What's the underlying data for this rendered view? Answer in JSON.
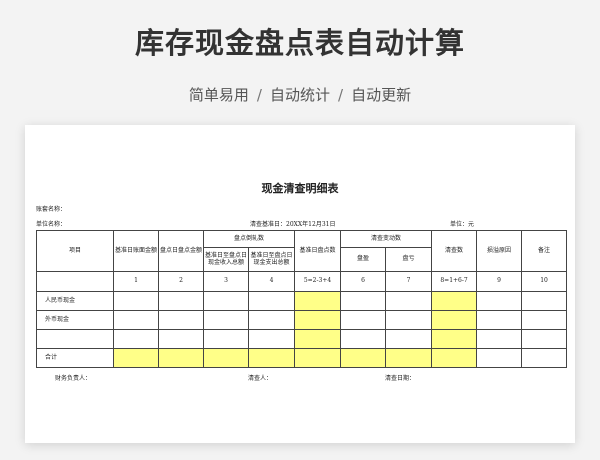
{
  "banner": {
    "title": "库存现金盘点表自动计算",
    "tags": [
      "简单易用",
      "自动统计",
      "自动更新"
    ],
    "separator": "/"
  },
  "document": {
    "title": "现金清查明细表",
    "account_name_label": "账套名称：",
    "unit_name_label": "单位名称：",
    "base_date_label": "清查基准日：20XX年12月31日",
    "unit_label": "单位：元",
    "headers": {
      "item": "项目",
      "base_book_balance": "基准日账面金额",
      "count_day_amount": "盘点日盘点金额",
      "count_adjustment": "盘点倒轧数",
      "income_total": "基准日至盘点日现金收入总额",
      "expense_total": "基准日至盘点日现金支出总额",
      "base_count_amount": "基准日盘点数",
      "change_amount": "清查变动数",
      "surplus": "盘盈",
      "loss": "盘亏",
      "audit_count": "清查数",
      "reason": "损溢原因",
      "remarks": "备注"
    },
    "column_numbers": [
      "1",
      "2",
      "3",
      "4",
      "5=2-3+4",
      "6",
      "7",
      "8=1+6-7",
      "9",
      "10"
    ],
    "rows": [
      "人民币现金",
      "外币现金",
      "",
      "合计"
    ],
    "footer": {
      "finance_manager": "财务负责人：",
      "auditor": "清查人：",
      "audit_date": "清查日期："
    }
  },
  "colors": {
    "highlight": "#ffff88",
    "background": "#f3f3f3",
    "sheet": "#ffffff",
    "title_text": "#333333"
  }
}
